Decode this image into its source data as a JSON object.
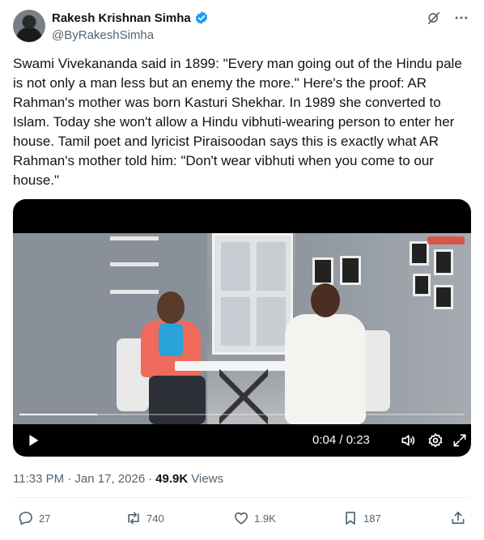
{
  "author": {
    "display_name": "Rakesh Krishnan Simha",
    "handle": "@ByRakeshSimha",
    "verified": true
  },
  "tweet": {
    "text": "Swami Vivekananda said in 1899: \"Every man going out of the Hindu pale is not only a man less but an enemy the more.\" Here's the proof: AR Rahman's mother was born Kasturi Shekhar. In 1989 she converted to Islam. Today she won't allow a Hindu vibhuti-wearing person to enter her house. Tamil poet and lyricist Piraisoodan says this is exactly what AR Rahman's mother told him: \"Don't wear vibhuti when you come to our house.\""
  },
  "video": {
    "time_display": "0:04 / 0:23",
    "progress": 0.174
  },
  "meta": {
    "timestamp": "11:33 PM · Jan 17, 2026",
    "separator": "·",
    "views_count": "49.9K",
    "views_label": "Views"
  },
  "actions": {
    "replies": "27",
    "reposts": "740",
    "likes": "1.9K",
    "bookmarks": "187"
  },
  "icons": {
    "top": [
      "grok-icon",
      "more-icon"
    ],
    "video": [
      "play-icon",
      "volume-icon",
      "settings-icon",
      "fullscreen-icon"
    ],
    "actions": [
      "reply-icon",
      "repost-icon",
      "like-icon",
      "bookmark-icon",
      "share-icon"
    ]
  },
  "colors": {
    "text": "#0f1419",
    "muted": "#536471",
    "verified": "#1d9bf0"
  }
}
